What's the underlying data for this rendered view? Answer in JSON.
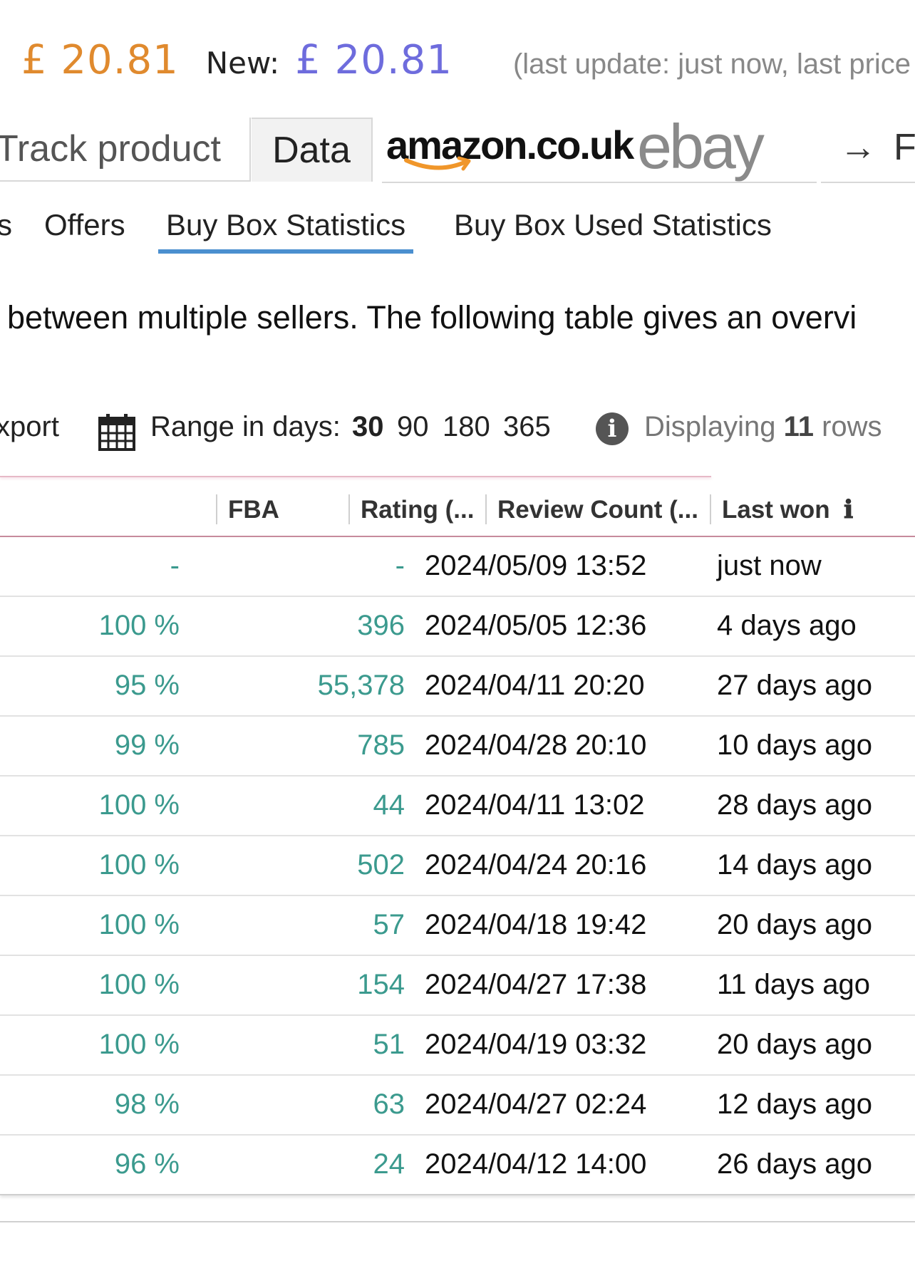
{
  "price": {
    "main": "£ 20.81",
    "new_label": "New:",
    "new_price": "£ 20.81",
    "last_update": "(last update: just now,  last price"
  },
  "top_tabs": {
    "track": "Track product",
    "data": "Data",
    "amazon": "amazon.co.uk",
    "ebay": "ebay",
    "arrow": "→",
    "more": "F"
  },
  "sub_tabs": [
    {
      "label": "s"
    },
    {
      "label": "Offers"
    },
    {
      "label": "Buy Box Statistics",
      "active": true
    },
    {
      "label": "Buy Box Used Statistics"
    }
  ],
  "description": "between multiple sellers. The following table gives an overvi",
  "toolbar": {
    "export": "xport",
    "range_label": "Range in days:",
    "ranges": [
      "30",
      "90",
      "180",
      "365"
    ],
    "selected_range": "30",
    "displaying_prefix": "Displaying",
    "displaying_count": "11",
    "displaying_suffix": "rows"
  },
  "table": {
    "headers": {
      "fba": "FBA",
      "rating": "Rating (...",
      "review_count": "Review Count (...",
      "last_won": "Last won",
      "last_won_info": "ℹ"
    },
    "rows": [
      {
        "rating_pct": "-",
        "review_count": "-",
        "date": "2024/05/09 13:52",
        "last_won": "just now"
      },
      {
        "rating_pct": "100 %",
        "review_count": "396",
        "date": "2024/05/05 12:36",
        "last_won": "4 days ago"
      },
      {
        "rating_pct": "95 %",
        "review_count": "55,378",
        "date": "2024/04/11 20:20",
        "last_won": "27 days ago"
      },
      {
        "rating_pct": "99 %",
        "review_count": "785",
        "date": "2024/04/28 20:10",
        "last_won": "10 days ago"
      },
      {
        "rating_pct": "100 %",
        "review_count": "44",
        "date": "2024/04/11 13:02",
        "last_won": "28 days ago"
      },
      {
        "rating_pct": "100 %",
        "review_count": "502",
        "date": "2024/04/24 20:16",
        "last_won": "14 days ago"
      },
      {
        "rating_pct": "100 %",
        "review_count": "57",
        "date": "2024/04/18 19:42",
        "last_won": "20 days ago"
      },
      {
        "rating_pct": "100 %",
        "review_count": "154",
        "date": "2024/04/27 17:38",
        "last_won": "11 days ago"
      },
      {
        "rating_pct": "100 %",
        "review_count": "51",
        "date": "2024/04/19 03:32",
        "last_won": "20 days ago"
      },
      {
        "rating_pct": "98 %",
        "review_count": "63",
        "date": "2024/04/27 02:24",
        "last_won": "12 days ago"
      },
      {
        "rating_pct": "96 %",
        "review_count": "24",
        "date": "2024/04/12 14:00",
        "last_won": "26 days ago"
      }
    ]
  },
  "colors": {
    "price_orange": "#e08a2e",
    "new_price_blue": "#6e6cdd",
    "teal_values": "#3b9a8e",
    "active_tab_underline": "#4b8fcf",
    "header_border": "#c78a9c"
  },
  "icons": {
    "calendar": "calendar-icon",
    "info": "info-icon",
    "arrow": "arrow-right-icon"
  }
}
